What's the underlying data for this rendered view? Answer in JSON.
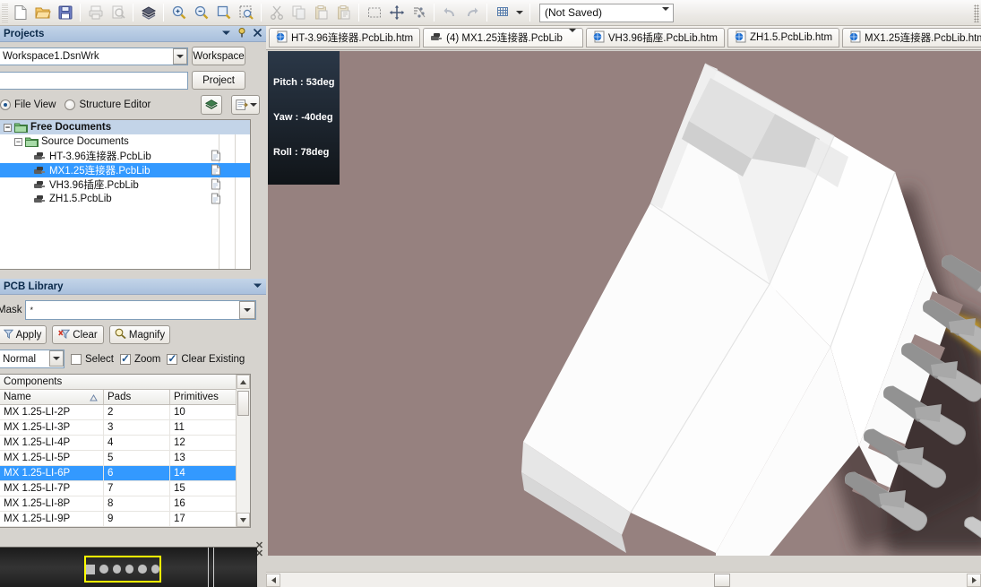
{
  "toolbar": {
    "icons": [
      {
        "name": "new-document-icon",
        "title": "New"
      },
      {
        "name": "open-folder-icon",
        "title": "Open"
      },
      {
        "name": "save-icon",
        "title": "Save"
      },
      {
        "name": "print-icon",
        "title": "Print"
      },
      {
        "name": "print-preview-icon",
        "title": "Print Preview"
      },
      {
        "name": "board-layers-icon",
        "title": "Board Insight"
      },
      {
        "name": "zoom-in-icon",
        "title": "Zoom In"
      },
      {
        "name": "zoom-out-icon",
        "title": "Zoom Out"
      },
      {
        "name": "zoom-document-icon",
        "title": "Fit Document"
      },
      {
        "name": "zoom-area-icon",
        "title": "Zoom Area"
      },
      {
        "name": "cut-icon",
        "title": "Cut"
      },
      {
        "name": "copy-icon",
        "title": "Copy"
      },
      {
        "name": "paste-icon",
        "title": "Paste"
      },
      {
        "name": "paste-special-icon",
        "title": "Paste Special"
      },
      {
        "name": "select-area-icon",
        "title": "Select"
      },
      {
        "name": "move-icon",
        "title": "Move"
      },
      {
        "name": "deselect-icon",
        "title": "Clear Selection"
      },
      {
        "name": "undo-icon",
        "title": "Undo"
      },
      {
        "name": "redo-icon",
        "title": "Redo"
      },
      {
        "name": "grid-icon",
        "title": "Snap Grid"
      }
    ],
    "snapshot_value": "(Not Saved)"
  },
  "tabs": [
    {
      "label": "HT-3.96连接器.PcbLib.htm",
      "icon": "browser-page-icon",
      "active": false,
      "dropdown": false
    },
    {
      "label": "(4) MX1.25连接器.PcbLib",
      "icon": "pcb-library-icon",
      "active": true,
      "dropdown": true
    },
    {
      "label": "VH3.96插座.PcbLib.htm",
      "icon": "browser-page-icon",
      "active": false,
      "dropdown": false
    },
    {
      "label": "ZH1.5.PcbLib.htm",
      "icon": "browser-page-icon",
      "active": false,
      "dropdown": false
    },
    {
      "label": "MX1.25连接器.PcbLib.htm",
      "icon": "browser-page-icon",
      "active": false,
      "dropdown": false
    }
  ],
  "projects_panel": {
    "title": "Projects",
    "workspace_value": "Workspace1.DsnWrk",
    "workspace_button": "Workspace",
    "project_value": "",
    "project_button": "Project",
    "view_modes": [
      {
        "label": "File View",
        "selected": true
      },
      {
        "label": "Structure Editor",
        "selected": false
      }
    ],
    "tree": [
      {
        "label": "Free Documents",
        "level": 0,
        "expander": "-",
        "icon": "folder-icon",
        "selected": false,
        "root": true,
        "doc": false
      },
      {
        "label": "Source Documents",
        "level": 1,
        "expander": "-",
        "icon": "folder-icon",
        "selected": false,
        "root": false,
        "doc": false
      },
      {
        "label": "HT-3.96连接器.PcbLib",
        "level": 2,
        "expander": "",
        "icon": "pcb-library-icon",
        "selected": false,
        "root": false,
        "doc": true
      },
      {
        "label": "MX1.25连接器.PcbLib",
        "level": 2,
        "expander": "",
        "icon": "pcb-library-icon",
        "selected": true,
        "root": false,
        "doc": true
      },
      {
        "label": "VH3.96插座.PcbLib",
        "level": 2,
        "expander": "",
        "icon": "pcb-library-icon",
        "selected": false,
        "root": false,
        "doc": true
      },
      {
        "label": "ZH1.5.PcbLib",
        "level": 2,
        "expander": "",
        "icon": "pcb-library-icon",
        "selected": false,
        "root": false,
        "doc": true
      }
    ]
  },
  "pcb_library_panel": {
    "title": "PCB Library",
    "mask_label": "Mask",
    "mask_value": "*",
    "buttons": [
      {
        "label": "Apply",
        "icon": "funnel-icon",
        "name": "apply-button"
      },
      {
        "label": "Clear",
        "icon": "clear-funnel-icon",
        "name": "clear-button"
      },
      {
        "label": "Magnify",
        "icon": "magnify-icon",
        "name": "magnify-button"
      }
    ],
    "mode_value": "Normal",
    "checks": [
      {
        "label": "Select",
        "checked": false,
        "accel": "S"
      },
      {
        "label": "Zoom",
        "checked": true,
        "accel": "Z"
      },
      {
        "label": "Clear Existing",
        "checked": true,
        "accel": "C"
      }
    ],
    "components_title": "Components",
    "columns": [
      "Name",
      "Pads",
      "Primitives"
    ],
    "sort_column": "Name",
    "sort_dir": "asc",
    "rows": [
      {
        "name": "MX 1.25-LI-2P",
        "pads": "2",
        "primitives": "10",
        "selected": false
      },
      {
        "name": "MX 1.25-LI-3P",
        "pads": "3",
        "primitives": "11",
        "selected": false
      },
      {
        "name": "MX 1.25-LI-4P",
        "pads": "4",
        "primitives": "12",
        "selected": false
      },
      {
        "name": "MX 1.25-LI-5P",
        "pads": "5",
        "primitives": "13",
        "selected": false
      },
      {
        "name": "MX 1.25-LI-6P",
        "pads": "6",
        "primitives": "14",
        "selected": true
      },
      {
        "name": "MX 1.25-LI-7P",
        "pads": "7",
        "primitives": "15",
        "selected": false
      },
      {
        "name": "MX 1.25-LI-8P",
        "pads": "8",
        "primitives": "16",
        "selected": false
      },
      {
        "name": "MX 1.25-LI-9P",
        "pads": "9",
        "primitives": "17",
        "selected": false
      }
    ]
  },
  "viewport": {
    "info": {
      "pitch_label": "Pitch",
      "pitch_value": "53deg",
      "yaw_label": "Yaw",
      "yaw_value": "-40deg",
      "roll_label": "Roll",
      "roll_value": "78deg",
      "text": "Pitch : 53deg\nYaw : -40deg\nRoll : 78deg"
    },
    "background_color": "#96817f",
    "model_color": "#f4f3f1",
    "light_color": "#d99a33"
  },
  "layer_bar": {
    "layers": [
      "square",
      "circle",
      "circle",
      "circle",
      "circle",
      "circle"
    ],
    "highlight_color": "#ffff00"
  }
}
